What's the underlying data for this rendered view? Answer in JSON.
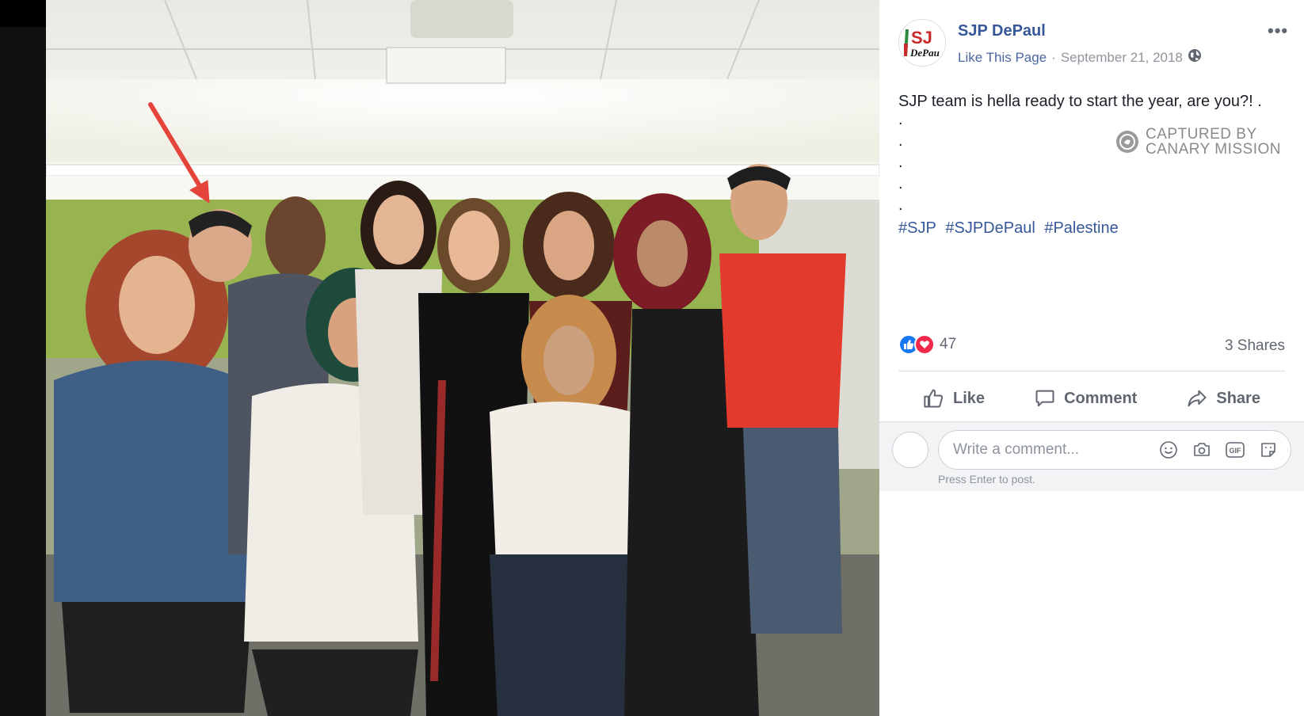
{
  "post": {
    "page_name": "SJP DePaul",
    "like_page": "Like This Page",
    "separator": "·",
    "date": "September 21, 2018",
    "more": "•••",
    "text_line": "SJP team is hella ready to start the year, are you?! .",
    "dots": [
      ".",
      ".",
      ".",
      ".",
      "."
    ],
    "hashtags": [
      "#SJP",
      "#SJPDePaul",
      "#Palestine"
    ]
  },
  "avatar": {
    "logo_text_top": "SJ",
    "logo_text_bottom": "DePaul"
  },
  "watermark": {
    "line1": "CAPTURED BY",
    "line2": "CANARY MISSION"
  },
  "stats": {
    "reaction_count": "47",
    "shares": "3 Shares"
  },
  "actions": {
    "like": "Like",
    "comment": "Comment",
    "share": "Share"
  },
  "comment": {
    "placeholder": "Write a comment...",
    "hint": "Press Enter to post."
  },
  "colors": {
    "link": "#365899",
    "like_blue": "#1877f2",
    "love_red": "#f0284a"
  }
}
